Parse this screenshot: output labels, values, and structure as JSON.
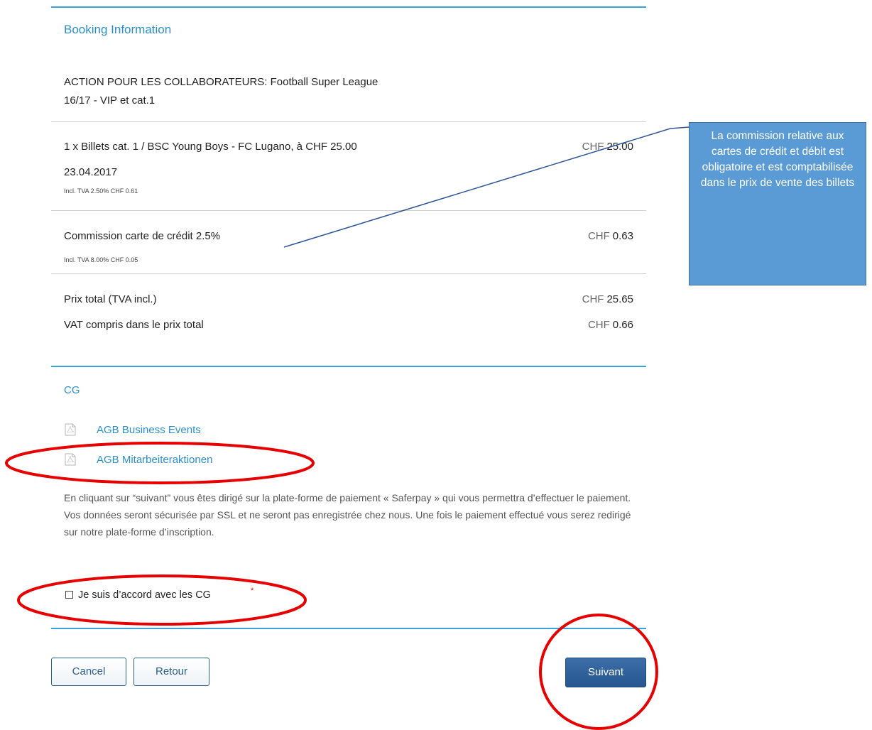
{
  "booking": {
    "section_title": "Booking Information",
    "event_title_line1": "ACTION POUR LES COLLABORATEURS: Football Super League",
    "event_title_line2": "16/17 - VIP et cat.1",
    "items": [
      {
        "description": "1 x Billets cat. 1 / BSC Young Boys - FC Lugano, à CHF 25.00",
        "date": "23.04.2017",
        "vat_note": "Incl. TVA 2.50% CHF 0.61",
        "currency": "CHF",
        "amount": "25.00"
      },
      {
        "description": "Commission carte de crédit 2.5%",
        "vat_note": "Incl. TVA 8.00% CHF 0.05",
        "currency": "CHF",
        "amount": "0.63"
      }
    ],
    "total_label": "Prix total (TVA incl.)",
    "total_currency": "CHF",
    "total_amount": "25.65",
    "vat_label": "VAT compris dans le prix total",
    "vat_currency": "CHF",
    "vat_amount": "0.66"
  },
  "terms": {
    "section_title": "CG",
    "links": [
      {
        "label": "AGB Business Events",
        "icon": "pdf-icon"
      },
      {
        "label": "AGB Mitarbeiteraktionen",
        "icon": "pdf-icon"
      }
    ],
    "info_text": "En cliquant sur “suivant” vous êtes dirigé sur la plate-forme de paiement « Saferpay » qui vous permettra d’effectuer le paiement. Vos données seront sécurisée par SSL et ne seront pas enregistrée chez nous. Une fois le paiement effectué vous serez redirigé sur notre plate-forme d’inscription.",
    "agree_label": "Je suis d’accord avec les CG",
    "required_mark": "*",
    "agree_checked": false
  },
  "buttons": {
    "cancel": "Cancel",
    "back": "Retour",
    "next": "Suivant"
  },
  "annotation": {
    "callout_text": "La commission relative aux cartes de crédit et débit est obligatoire et est comptabilisée dans le prix de vente des billets",
    "callout_color": "#5b9bd5",
    "highlight_color": "#e60000"
  },
  "colors": {
    "accent": "#2a8fc9",
    "primary_button": "#2f60a0"
  }
}
